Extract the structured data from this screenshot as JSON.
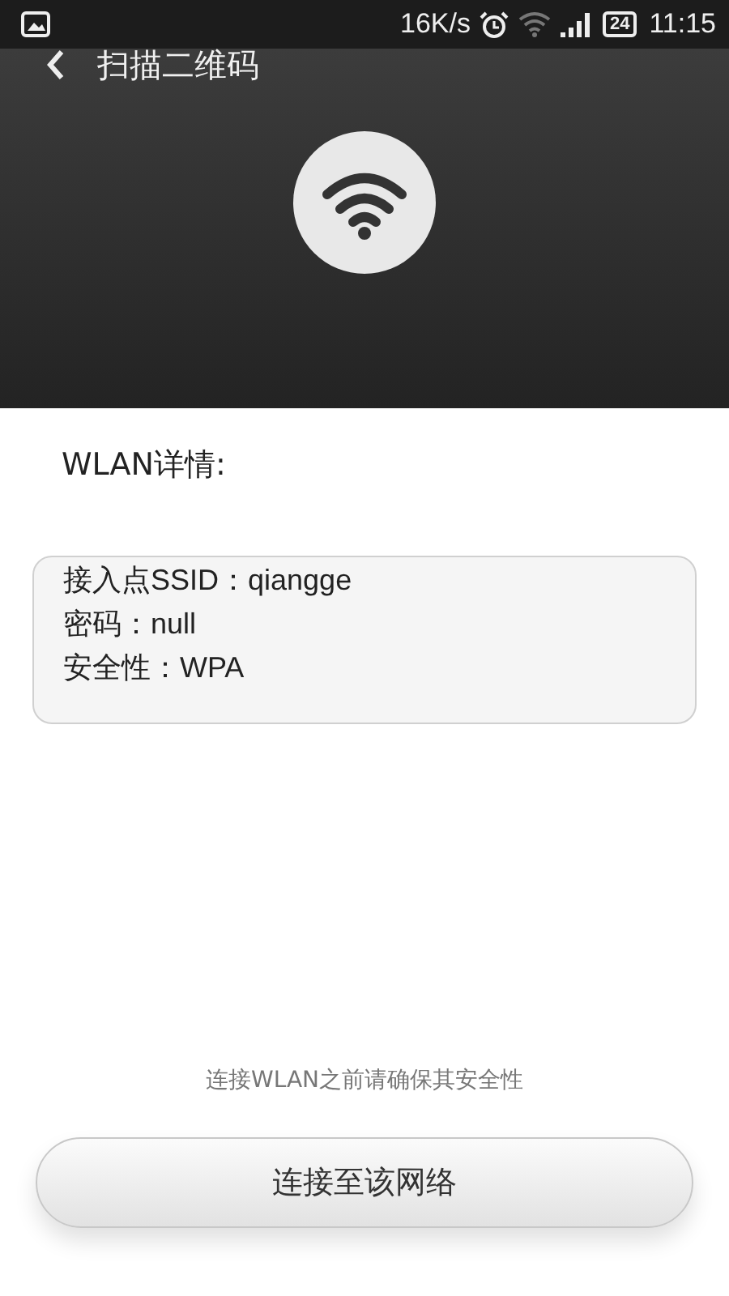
{
  "status_bar": {
    "speed": "16K/s",
    "battery": "24",
    "time": "11:15"
  },
  "header": {
    "title": "扫描二维码"
  },
  "section_title": "WLAN详情:",
  "details": [
    "接入点SSID：qiangge",
    "密码：null",
    "安全性：WPA"
  ],
  "note": "连接WLAN之前请确保其安全性",
  "button": "连接至该网络"
}
